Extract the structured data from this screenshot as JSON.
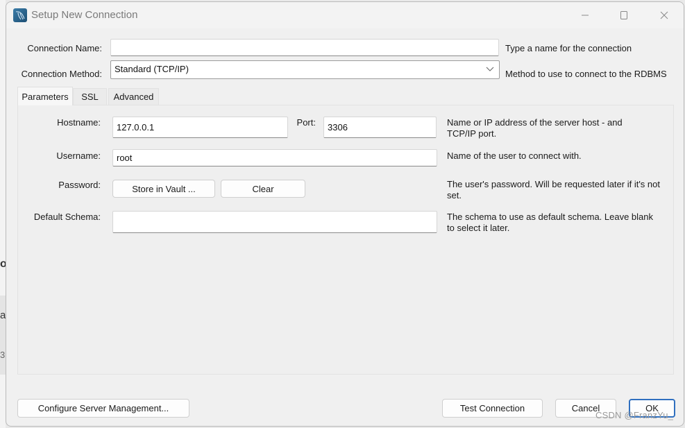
{
  "window": {
    "title": "Setup New Connection",
    "controls": {
      "minimize": "minimize",
      "maximize": "maximize",
      "close": "close"
    }
  },
  "background_fragments": [
    "o",
    "ar",
    "3"
  ],
  "connection_name": {
    "label": "Connection Name:",
    "value": "",
    "hint": "Type a name for the connection"
  },
  "connection_method": {
    "label": "Connection Method:",
    "selected": "Standard (TCP/IP)",
    "hint": "Method to use to connect to the RDBMS"
  },
  "tabs": [
    {
      "label": "Parameters",
      "active": true
    },
    {
      "label": "SSL",
      "active": false
    },
    {
      "label": "Advanced",
      "active": false
    }
  ],
  "parameters": {
    "hostname": {
      "label": "Hostname:",
      "value": "127.0.0.1"
    },
    "port": {
      "label": "Port:",
      "value": "3306"
    },
    "host_hint": "Name or IP address of the server host - and TCP/IP port.",
    "username": {
      "label": "Username:",
      "value": "root",
      "hint": "Name of the user to connect with."
    },
    "password": {
      "label": "Password:",
      "store_button": "Store in Vault ...",
      "clear_button": "Clear",
      "hint": "The user's password. Will be requested later if it's not set."
    },
    "default_schema": {
      "label": "Default Schema:",
      "value": "",
      "hint": "The schema to use as default schema. Leave blank to select it later."
    }
  },
  "footer": {
    "configure_button": "Configure Server Management...",
    "test_button": "Test Connection",
    "cancel_button": "Cancel",
    "ok_button": "OK"
  },
  "watermark": "CSDN @FranzYu_",
  "colors": {
    "accent": "#2f6fbf",
    "window_bg": "#f0f0f0",
    "title_text": "#7a7a7a"
  }
}
